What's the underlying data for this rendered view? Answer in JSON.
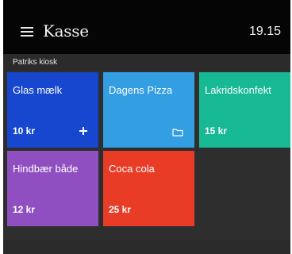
{
  "header": {
    "menu_icon": "hamburger-menu-icon",
    "title": "Kasse",
    "time": "19.15"
  },
  "shop": {
    "name": "Patriks kiosk"
  },
  "tiles": [
    {
      "name": "Glas mælk",
      "price": "10 kr",
      "color": "#1747cf",
      "icon": "plus-icon"
    },
    {
      "name": "Dagens Pizza",
      "price": "",
      "color": "#339ee2",
      "icon": "folder-icon"
    },
    {
      "name": "Lakridskonfekt",
      "price": "15 kr",
      "color": "#17b894",
      "icon": ""
    },
    {
      "name": "Hindbær både",
      "price": "12 kr",
      "color": "#8f4fc0",
      "icon": ""
    },
    {
      "name": "Coca cola",
      "price": "25 kr",
      "color": "#e83c27",
      "icon": ""
    }
  ],
  "colors": {
    "topbar": "#050505",
    "background": "#2e2e2e"
  }
}
